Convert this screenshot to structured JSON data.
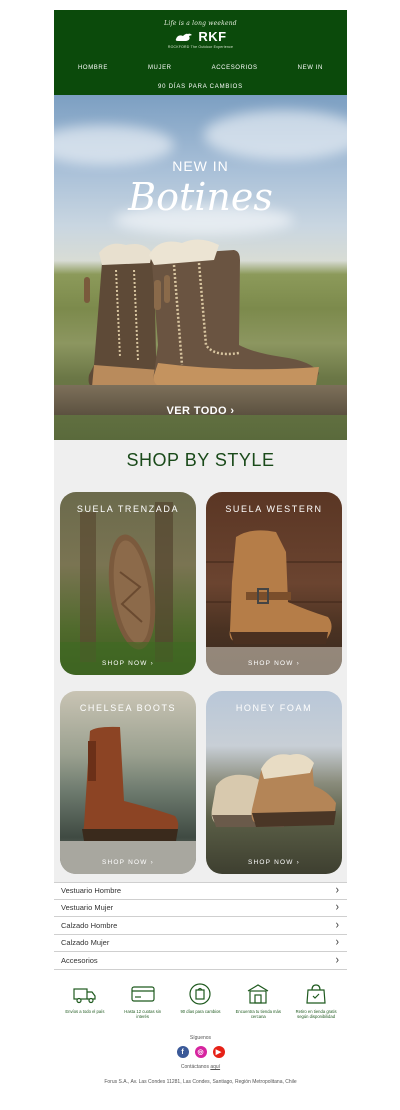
{
  "header": {
    "tagline": "Life is a long weekend",
    "logo": "RKF",
    "logo_sub": "ROCKFORD The Outdoor Experience",
    "nav": [
      "HOMBRE",
      "MUJER",
      "ACCESORIOS",
      "NEW IN"
    ],
    "promo": "90 DÍAS PARA CAMBIOS"
  },
  "hero": {
    "subtitle": "NEW IN",
    "title": "Botines",
    "cta": "VER TODO"
  },
  "styles": {
    "title": "SHOP BY STYLE",
    "cards": [
      {
        "label": "SUELA TRENZADA",
        "cta": "SHOP NOW"
      },
      {
        "label": "SUELA WESTERN",
        "cta": "SHOP NOW"
      },
      {
        "label": "CHELSEA BOOTS",
        "cta": "SHOP NOW"
      },
      {
        "label": "HONEY FOAM",
        "cta": "SHOP NOW"
      }
    ]
  },
  "menu": [
    "Vestuario Hombre",
    "Vestuario Mujer",
    "Calzado Hombre",
    "Calzado Mujer",
    "Accesorios"
  ],
  "benefits": [
    {
      "icon": "truck-icon",
      "text": "Envíos a todo el país"
    },
    {
      "icon": "credit-card-icon",
      "text": "Hasta 12 cuotas sin interés"
    },
    {
      "icon": "exchange-icon",
      "text": "90 días para cambios"
    },
    {
      "icon": "store-icon",
      "text": "Encuentra tu tienda más cercana"
    },
    {
      "icon": "pickup-bag-icon",
      "text": "Retiro en tienda gratis según disponibilidad"
    }
  ],
  "footer": {
    "follow": "Síguenos",
    "contact_prefix": "Contáctanos",
    "contact_link": "aquí",
    "address": "Forus S.A., Av. Las Condes 11281, Las Condes, Santiago, Región Metropolitana, Chile"
  },
  "colors": {
    "brand_green": "#0b4a0b",
    "facebook": "#3b5998",
    "instagram": "#d6249f",
    "youtube": "#e62117"
  }
}
